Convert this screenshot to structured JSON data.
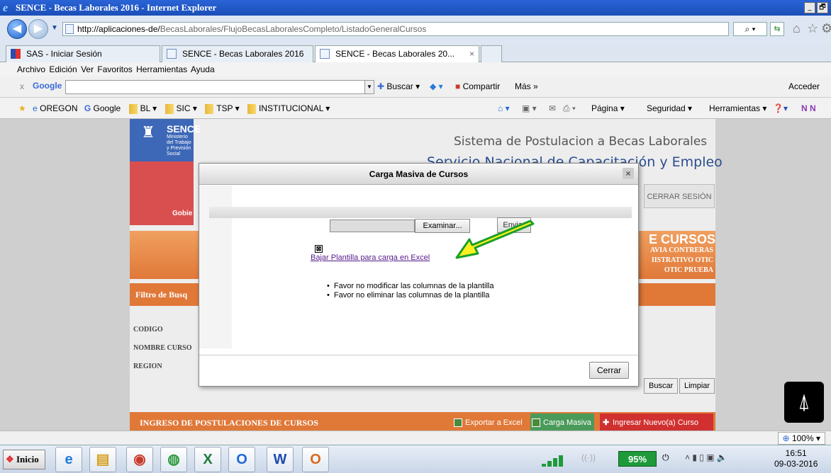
{
  "window": {
    "title": "SENCE - Becas Laborales 2016 - Internet Explorer",
    "controls": [
      "_",
      "🗗"
    ]
  },
  "address": {
    "url_host": "http://aplicaciones-de/",
    "url_path": "BecasLaborales/FlujoBecasLaboralesCompleto/ListadoGeneralCursos"
  },
  "tabs": [
    {
      "label": "SAS - Iniciar Sesión",
      "active": false
    },
    {
      "label": "SENCE - Becas Laborales 2016",
      "active": false
    },
    {
      "label": "SENCE - Becas Laborales 20...",
      "active": true
    }
  ],
  "menu": {
    "items": [
      "Archivo",
      "Edición",
      "Ver",
      "Favoritos",
      "Herramientas",
      "Ayuda"
    ]
  },
  "google_toolbar": {
    "close": "x",
    "logo": "Google",
    "buscar": "Buscar",
    "compartir": "Compartir",
    "mas": "Más »",
    "acceder": "Acceder"
  },
  "favorites": {
    "items": [
      "OREGON",
      "Google",
      "BL ▾",
      "SIC ▾",
      "TSP ▾",
      "INSTITUCIONAL ▾"
    ],
    "right": [
      "Página ▾",
      "Seguridad ▾",
      "Herramientas ▾"
    ]
  },
  "page": {
    "logo_title": "SENCE",
    "logo_sub": "Ministerio del Trabajo y Previsión Social",
    "logo_gob": "Gobie",
    "system_title": "Sistema de Postulacion a Becas Laborales",
    "service_title": "Servicio Nacional de Capacitación y Empleo",
    "cerrar_sesion": "CERRAR SESIÓN",
    "band_title": "E CURSOS",
    "band_lines": [
      "AVIA CONTRERAS",
      "IISTRATIVO OTIC",
      "OTIC PRUEBA"
    ],
    "filtro": "Filtro de Busq",
    "labels": {
      "codigo": "CODIGO",
      "nombre": "NOMBRE CURSO",
      "region": "REGION"
    },
    "buscar": "Buscar",
    "limpiar": "Limpiar",
    "ingreso": "INGRESO DE POSTULACIONES DE CURSOS",
    "exportar": "Exportar a Excel",
    "carga_masiva": "Carga Masiva",
    "nuevo": "Ingresar Nuevo(a) Curso"
  },
  "modal": {
    "title": "Carga Masiva de Cursos",
    "close": "×",
    "examinar": "Examinar...",
    "enviar": "Enviar",
    "download_link": "Bajar Plantilla para carga en Excel",
    "notes": [
      "Favor no modificar las columnas de la plantilla",
      "Favor no eliminar las columnas de la plantilla"
    ],
    "cerrar": "Cerrar"
  },
  "statusbar": {
    "zoom": "100%"
  },
  "taskbar": {
    "start": "Inicio",
    "battery": "95%",
    "time": "16:51",
    "date": "09-03-2016"
  }
}
